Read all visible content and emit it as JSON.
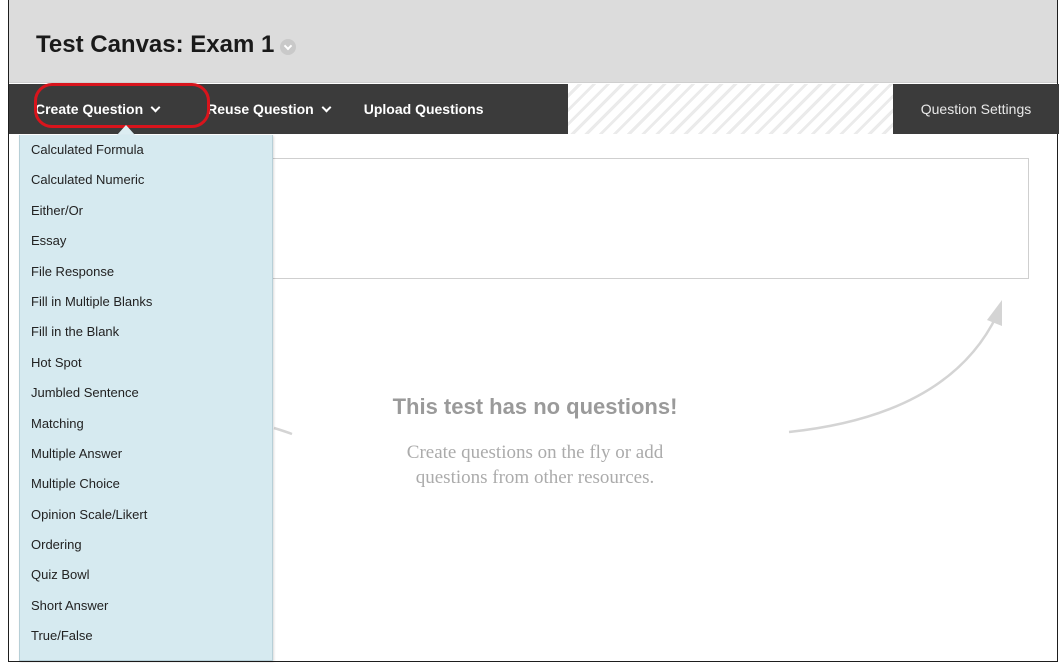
{
  "header": {
    "title": "Test Canvas: Exam 1"
  },
  "toolbar": {
    "create_label": "Create Question",
    "reuse_label": "Reuse Question",
    "upload_label": "Upload Questions",
    "settings_label": "Question Settings"
  },
  "menu": {
    "items": [
      "Calculated Formula",
      "Calculated Numeric",
      "Either/Or",
      "Essay",
      "File Response",
      "Fill in Multiple Blanks",
      "Fill in the Blank",
      "Hot Spot",
      "Jumbled Sentence",
      "Matching",
      "Multiple Answer",
      "Multiple Choice",
      "Opinion Scale/Likert",
      "Ordering",
      "Quiz Bowl",
      "Short Answer",
      "True/False"
    ]
  },
  "empty_state": {
    "title": "This test has no questions!",
    "line1": "Create questions on the fly or add",
    "line2": "questions from other resources."
  },
  "colors": {
    "toolbar_bg": "#3b3b3b",
    "menu_bg": "#d6eaf0",
    "highlight": "#d8141c",
    "header_bg": "#dcdcdc"
  }
}
